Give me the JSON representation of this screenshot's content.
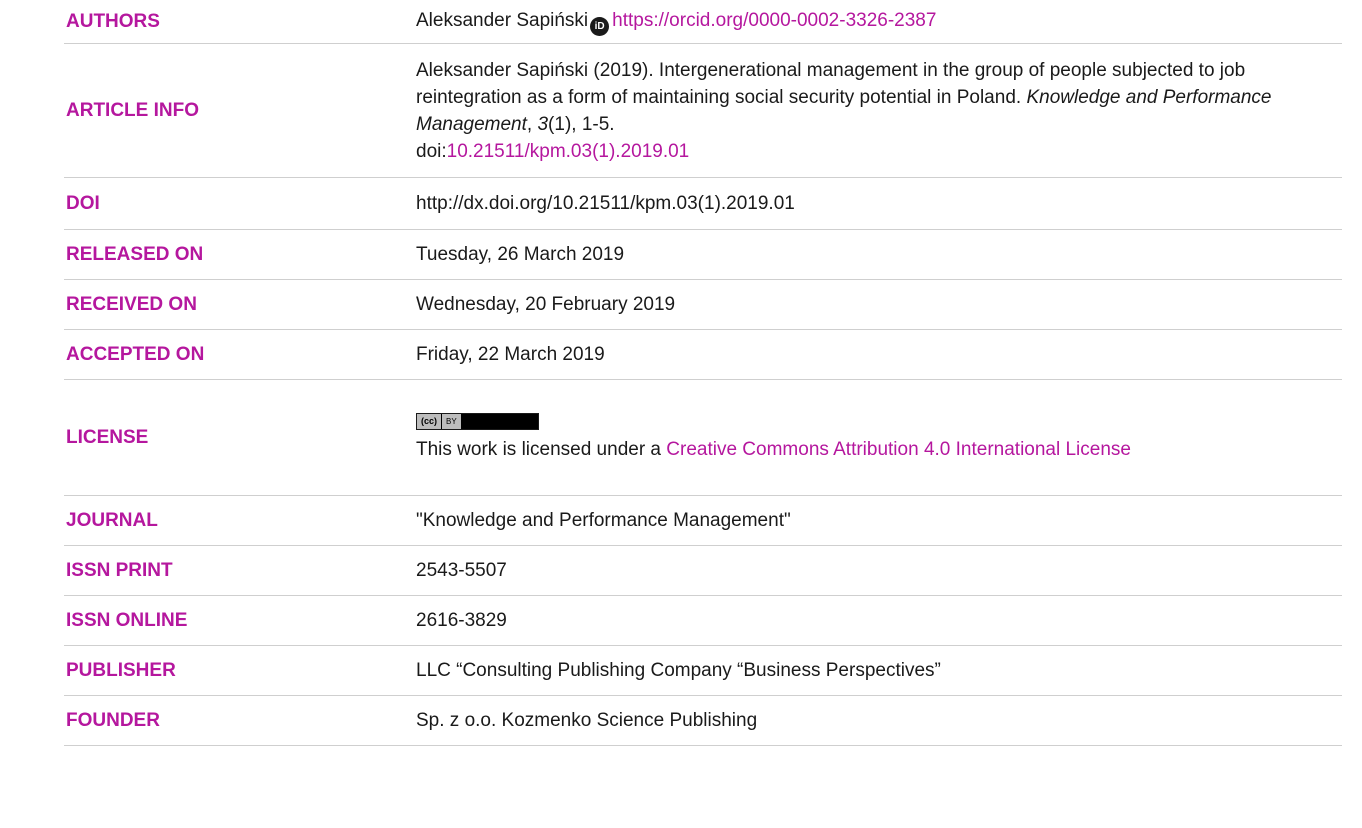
{
  "authors": {
    "label": "AUTHORS",
    "name": "Aleksander Sapiński",
    "orcid_icon": "orcid-icon",
    "orcid_url": "https://orcid.org/0000-0002-3326-2387"
  },
  "article_info": {
    "label": "ARTICLE INFO",
    "citation_prefix": "Aleksander Sapiński (2019). Intergenerational management in the group of people subjected to job reintegration as a form of maintaining social security potential in Poland. ",
    "journal_italic": "Knowledge and Performance Management",
    "comma": ", ",
    "volume_italic": "3",
    "citation_suffix": "(1), 1-5.",
    "doi_prefix": "doi:",
    "doi_link": "10.21511/kpm.03(1).2019.01"
  },
  "doi": {
    "label": "DOI",
    "value": "http://dx.doi.org/10.21511/kpm.03(1).2019.01"
  },
  "released_on": {
    "label": "RELEASED ON",
    "value": "Tuesday, 26 March 2019"
  },
  "received_on": {
    "label": "RECEIVED ON",
    "value": "Wednesday, 20 February 2019"
  },
  "accepted_on": {
    "label": "ACCEPTED ON",
    "value": "Friday, 22 March 2019"
  },
  "license": {
    "label": "LICENSE",
    "badge_cc": "(cc)",
    "badge_by": "BY",
    "text": "This work is licensed under a ",
    "link": "Creative Commons Attribution 4.0 International License"
  },
  "journal": {
    "label": "JOURNAL",
    "value": "\"Knowledge and Performance Management\""
  },
  "issn_print": {
    "label": "ISSN PRINT",
    "value": "2543-5507"
  },
  "issn_online": {
    "label": "ISSN ONLINE",
    "value": "2616-3829"
  },
  "publisher": {
    "label": "PUBLISHER",
    "value": "LLC “Consulting Publishing Company “Business Perspectives”"
  },
  "founder": {
    "label": "FOUNDER",
    "value": "Sp. z o.o. Kozmenko Science Publishing"
  },
  "colors": {
    "accent": "#b5179e",
    "text": "#1a1a1a",
    "rule": "#cfcfcf"
  }
}
